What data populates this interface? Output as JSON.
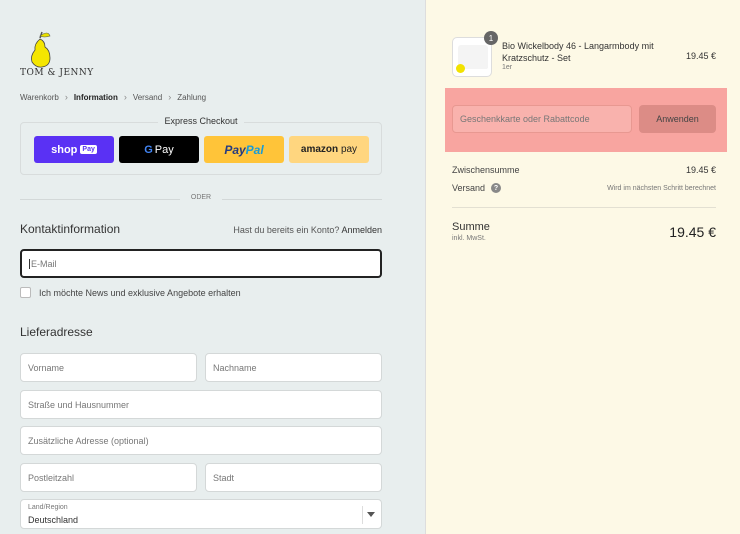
{
  "brand": {
    "name": "TOM & JENNY"
  },
  "breadcrumb": [
    "Warenkorb",
    "Information",
    "Versand",
    "Zahlung"
  ],
  "express": {
    "title": "Express Checkout",
    "shop_pay": {
      "shop": "shop",
      "pay": "Pay"
    },
    "google_pay": {
      "g": "G",
      "label": "Pay"
    },
    "paypal": {
      "pay": "Pay",
      "pal": "Pal"
    },
    "amazon_pay": {
      "amazon": "amazon",
      "pay": "pay"
    }
  },
  "divider_text": "ODER",
  "contact": {
    "title": "Kontaktinformation",
    "login_prompt": "Hast du bereits ein Konto?",
    "login_link": "Anmelden",
    "email_placeholder": "E-Mail",
    "newsletter_label": "Ich möchte News und exklusive Angebote erhalten"
  },
  "shipping": {
    "title": "Lieferadresse",
    "first_name": "Vorname",
    "last_name": "Nachname",
    "street": "Straße und Hausnummer",
    "address2": "Zusätzliche Adresse (optional)",
    "zip": "Postleitzahl",
    "city": "Stadt",
    "country_label": "Land/Region",
    "country_value": "Deutschland"
  },
  "summary": {
    "product": {
      "name": "Bio Wickelbody 46 - Langarmbody mit Kratzschutz - Set",
      "variant": "1er",
      "quantity": "1",
      "price": "19.45 €"
    },
    "discount_placeholder": "Geschenkkarte oder Rabattcode",
    "apply_label": "Anwenden",
    "subtotal_label": "Zwischensumme",
    "subtotal_value": "19.45 €",
    "shipping_label": "Versand",
    "shipping_value": "Wird im nächsten Schritt berechnet",
    "total_label": "Summe",
    "total_sub": "inkl. MwSt.",
    "total_value": "19.45 €"
  },
  "colors": {
    "highlight": "#f8a5a0",
    "shop_pay": "#5a31f4",
    "paypal": "#ffc439",
    "amazon_pay": "#ffd67f",
    "pear": "#f2e200"
  }
}
